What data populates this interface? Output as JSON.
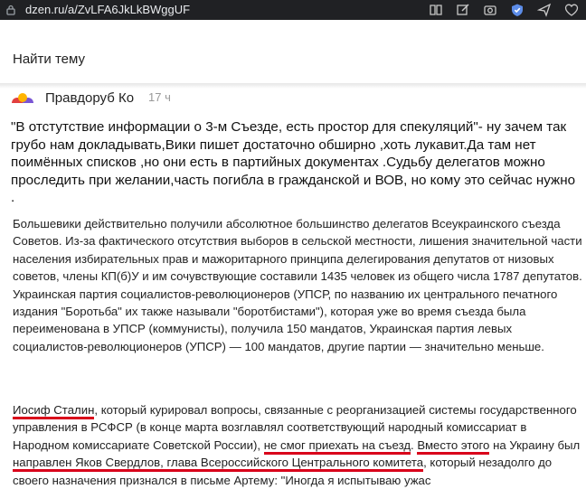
{
  "browser": {
    "url": "dzen.ru/a/ZvLFA6JkLkBWggUF"
  },
  "topic": {
    "label": "Найти тему"
  },
  "comment": {
    "author": "Правдоруб Ко",
    "time": "17 ч",
    "text": "\"В отстутствие информации о 3-м Съезде, есть простор для спекуляций\"- ну зачем так грубо нам докладывать,Вики пишет достаточно обширно ,хоть лукавит.Да там нет поимённых списков ,но они есть в партийных документах .Судьбу делегатов можно проследить при желании,часть погибла в гражданской и ВОВ, но кому это сейчас нужно ."
  },
  "quote": {
    "p1": "Большевики действительно получили абсолютное большинство делегатов Всеукраинского съезда Советов. Из-за фактического отсутствия выборов в сельской местности, лишения значительной части населения избирательных прав и мажоритарного принципа делегирования депутатов от низовых советов, члены КП(б)У и им сочувствующие составили 1435 человек из общего числа 1787 депутатов. Украинская партия социалистов-революционеров (УПСР, по названию их центрального печатного издания \"Боротьба\" их также называли \"боротбистами\"), которая уже во время съезда была переименована в УПСР (коммунисты), получила 150 мандатов, Украинская партия левых социалистов-революционеров (УПСР) — 100 мандатов, другие партии — значительно меньше.",
    "p2_a": "Иосиф Сталин",
    "p2_b": ", который курировал вопросы, связанные с реорганизацией системы государственного управления в РСФСР (в конце марта возглавлял соответствующий народный комиссариат в Народном комиссариате Советской России), ",
    "p2_c": "не смог приехать на съезд",
    "p2_d": ". ",
    "p2_e": "Вместо этого",
    "p2_f": " на Украину был ",
    "p2_g": "направлен Яков Свердлов, глава Всероссийского Центрального комитета",
    "p2_h": ", который незадолго до своего назначения признался в письме Артему: \"Иногда я испытываю ужас"
  },
  "colors": {
    "underline": "#d9001a",
    "addrbar": "#202124"
  }
}
